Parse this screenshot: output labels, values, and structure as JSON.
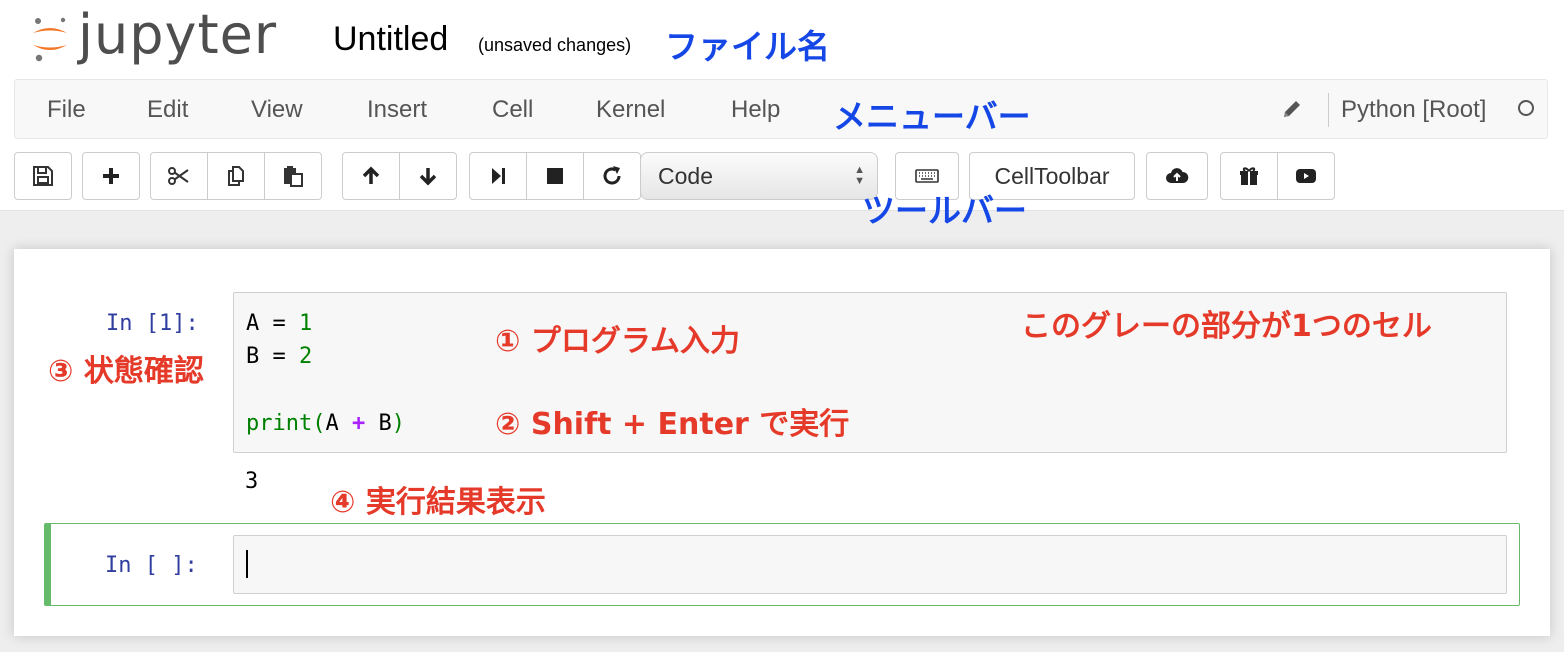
{
  "header": {
    "logo_text": "jupyter",
    "notebook_title": "Untitled",
    "save_status": "(unsaved changes)",
    "annotation_filename": "ファイル名"
  },
  "menubar": {
    "items": [
      "File",
      "Edit",
      "View",
      "Insert",
      "Cell",
      "Kernel",
      "Help"
    ],
    "annotation": "メニューバー",
    "kernel_name": "Python [Root]",
    "edit_icon": "pencil-icon",
    "kernel_status_icon": "kernel-idle-circle-icon"
  },
  "toolbar": {
    "icons": [
      "save-icon",
      "plus-icon",
      "scissors-icon",
      "copy-icon",
      "paste-icon",
      "arrow-up-icon",
      "arrow-down-icon",
      "step-forward-icon",
      "stop-icon",
      "restart-icon",
      "keyboard-icon",
      "cloud-upload-icon",
      "gift-icon",
      "play-video-icon"
    ],
    "cell_type": "Code",
    "celltoolbar_label": "CellToolbar",
    "annotation": "ツールバー"
  },
  "cells": {
    "cell1": {
      "prompt": "In [1]:",
      "output": "3"
    },
    "cell2": {
      "prompt": "In [ ]:"
    }
  },
  "annotations": {
    "gray_cell": "このグレーの部分が1つのセル",
    "step1": "① プログラム入力",
    "step2": "② Shift + Enter で実行",
    "step3": "③ 状態確認",
    "step4": "④ 実行結果表示"
  },
  "colors": {
    "annotation_blue": "#1447e6",
    "annotation_red": "#e53a2a",
    "prompt_blue": "#303f9f",
    "active_cell_green": "#66bb6a",
    "jupyter_orange": "#f37726"
  }
}
